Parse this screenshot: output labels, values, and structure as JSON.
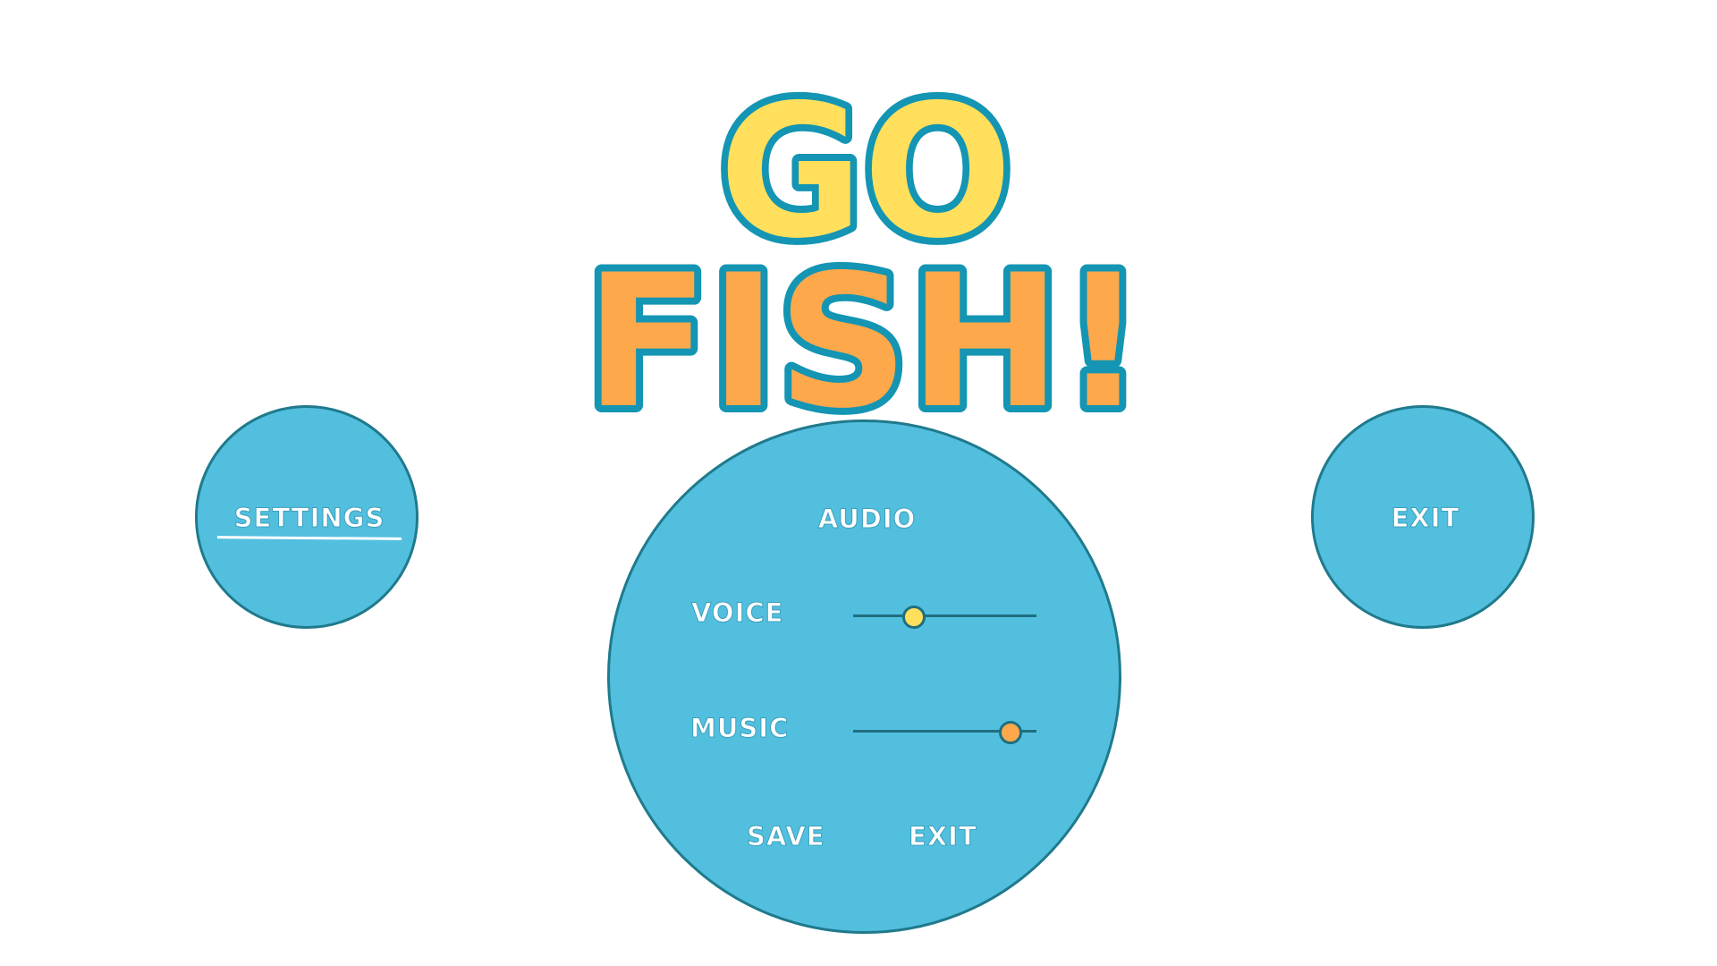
{
  "title": {
    "line1": "GO",
    "line2": "FISH!"
  },
  "colors": {
    "circle_fill": "#53bfdf",
    "circle_border": "#1f7a8c",
    "title_line1": "#ffdf5c",
    "title_line2": "#fda84b",
    "title_outline": "#1395b3",
    "voice_thumb": "#ffdf5c",
    "music_thumb": "#fda84b"
  },
  "side_menu": {
    "settings_label": "SETTINGS",
    "exit_label": "EXIT"
  },
  "settings_panel": {
    "heading": "AUDIO",
    "voice": {
      "label": "VOICE",
      "level": 0.33
    },
    "music": {
      "label": "MUSIC",
      "level": 0.86
    },
    "save_label": "SAVE",
    "exit_label": "EXIT"
  }
}
